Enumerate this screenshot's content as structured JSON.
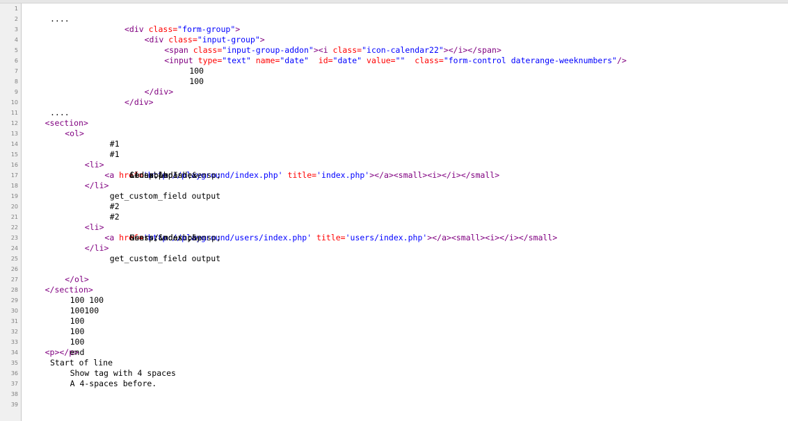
{
  "colors": {
    "text": "#000000",
    "tag": "#800080",
    "attribute": "#ff0000",
    "string": "#0000ff",
    "gutter_background": "#f0f0f0",
    "line_number": "#808080"
  },
  "lines": [
    {
      "n": "1",
      "indent": 0,
      "tokens": []
    },
    {
      "n": "2",
      "indent": 0,
      "tokens": [
        {
          "t": "txt",
          "v": "...."
        }
      ]
    },
    {
      "n": "3",
      "indent": 20,
      "tokens": [
        {
          "t": "tag",
          "v": "<div "
        },
        {
          "t": "attr",
          "v": "class="
        },
        {
          "t": "str",
          "v": "\"form-group\""
        },
        {
          "t": "tag",
          "v": ">"
        }
      ]
    },
    {
      "n": "4",
      "indent": 24,
      "tokens": [
        {
          "t": "tag",
          "v": "<div "
        },
        {
          "t": "attr",
          "v": "class="
        },
        {
          "t": "str",
          "v": "\"input-group\""
        },
        {
          "t": "tag",
          "v": ">"
        }
      ]
    },
    {
      "n": "5",
      "indent": 28,
      "tokens": [
        {
          "t": "tag",
          "v": "<span "
        },
        {
          "t": "attr",
          "v": "class="
        },
        {
          "t": "str",
          "v": "\"input-group-addon\""
        },
        {
          "t": "tag",
          "v": "><i "
        },
        {
          "t": "attr",
          "v": "class="
        },
        {
          "t": "str",
          "v": "\"icon-calendar22\""
        },
        {
          "t": "tag",
          "v": "></i></span>"
        }
      ]
    },
    {
      "n": "6",
      "indent": 28,
      "tokens": [
        {
          "t": "tag",
          "v": "<input "
        },
        {
          "t": "attr",
          "v": "type="
        },
        {
          "t": "str",
          "v": "\"text\""
        },
        {
          "t": "attr",
          "v": " name="
        },
        {
          "t": "str",
          "v": "\"date\""
        },
        {
          "t": "attr",
          "v": "  id="
        },
        {
          "t": "str",
          "v": "\"date\""
        },
        {
          "t": "attr",
          "v": " value="
        },
        {
          "t": "str",
          "v": "\"\""
        },
        {
          "t": "attr",
          "v": "  class="
        },
        {
          "t": "str",
          "v": "\"form-control daterange-weeknumbers\""
        },
        {
          "t": "tag",
          "v": "/>"
        }
      ]
    },
    {
      "n": "7",
      "indent": 28,
      "tokens": [
        {
          "t": "txt",
          "v": "100"
        }
      ]
    },
    {
      "n": "8",
      "indent": 28,
      "tokens": [
        {
          "t": "txt",
          "v": "100"
        }
      ]
    },
    {
      "n": "9",
      "indent": 24,
      "tokens": [
        {
          "t": "tag",
          "v": "</div>"
        }
      ]
    },
    {
      "n": "10",
      "indent": 20,
      "tokens": [
        {
          "t": "tag",
          "v": "</div>"
        }
      ]
    },
    {
      "n": "11",
      "indent": 0,
      "tokens": [
        {
          "t": "txt",
          "v": "...."
        }
      ]
    },
    {
      "n": "12",
      "indent": 4,
      "tokens": [
        {
          "t": "tag",
          "v": "<section>"
        }
      ]
    },
    {
      "n": "13",
      "indent": 8,
      "tokens": [
        {
          "t": "tag",
          "v": "<ol>"
        }
      ]
    },
    {
      "n": "14",
      "indent": 12,
      "tokens": [
        {
          "t": "txt",
          "v": "#1"
        }
      ]
    },
    {
      "n": "15",
      "indent": 12,
      "tokens": [
        {
          "t": "txt",
          "v": "#1"
        }
      ]
    },
    {
      "n": "16",
      "indent": 12,
      "tokens": [
        {
          "t": "tag",
          "v": "<li>"
        }
      ]
    },
    {
      "n": "17",
      "indent": 16,
      "tokens": [
        {
          "t": "tag",
          "v": "<a "
        },
        {
          "t": "attr",
          "v": "href="
        },
        {
          "t": "str",
          "v": "'http://playground/index.php'"
        },
        {
          "t": "attr",
          "v": " title="
        },
        {
          "t": "str",
          "v": "'index.php'"
        },
        {
          "t": "tag",
          "v": ">"
        },
        {
          "t": "txt",
          "v": "Clonable Index"
        },
        {
          "t": "tag",
          "v": "</a>"
        },
        {
          "t": "txt",
          "v": "&ensp;&mdash;&ensp;"
        },
        {
          "t": "tag",
          "v": "<small><i>"
        },
        {
          "t": "txt",
          "v": "index.php"
        },
        {
          "t": "tag",
          "v": "</i></small>"
        }
      ]
    },
    {
      "n": "18",
      "indent": 12,
      "tokens": [
        {
          "t": "tag",
          "v": "</li>"
        }
      ]
    },
    {
      "n": "19",
      "indent": 12,
      "tokens": [
        {
          "t": "txt",
          "v": "get_custom_field output"
        }
      ]
    },
    {
      "n": "20",
      "indent": 12,
      "tokens": [
        {
          "t": "txt",
          "v": "#2"
        }
      ]
    },
    {
      "n": "21",
      "indent": 12,
      "tokens": [
        {
          "t": "txt",
          "v": "#2"
        }
      ]
    },
    {
      "n": "22",
      "indent": 12,
      "tokens": [
        {
          "t": "tag",
          "v": "<li>"
        }
      ]
    },
    {
      "n": "23",
      "indent": 16,
      "tokens": [
        {
          "t": "tag",
          "v": "<a "
        },
        {
          "t": "attr",
          "v": "href="
        },
        {
          "t": "str",
          "v": "'http://playground/users/index.php'"
        },
        {
          "t": "attr",
          "v": " title="
        },
        {
          "t": "str",
          "v": "'users/index.php'"
        },
        {
          "t": "tag",
          "v": ">"
        },
        {
          "t": "txt",
          "v": "Users"
        },
        {
          "t": "tag",
          "v": "</a>"
        },
        {
          "t": "txt",
          "v": "&ensp;&mdash;&ensp;"
        },
        {
          "t": "tag",
          "v": "<small><i>"
        },
        {
          "t": "txt",
          "v": "users/index.php"
        },
        {
          "t": "tag",
          "v": "</i></small>"
        }
      ]
    },
    {
      "n": "24",
      "indent": 12,
      "tokens": [
        {
          "t": "tag",
          "v": "</li>"
        }
      ]
    },
    {
      "n": "25",
      "indent": 12,
      "tokens": [
        {
          "t": "txt",
          "v": "get_custom_field output"
        }
      ]
    },
    {
      "n": "26",
      "indent": 0,
      "tokens": []
    },
    {
      "n": "27",
      "indent": 8,
      "tokens": [
        {
          "t": "tag",
          "v": "</ol>"
        }
      ]
    },
    {
      "n": "28",
      "indent": 4,
      "tokens": [
        {
          "t": "tag",
          "v": "</section>"
        }
      ]
    },
    {
      "n": "29",
      "indent": 4,
      "tokens": [
        {
          "t": "txt",
          "v": "100 100"
        }
      ]
    },
    {
      "n": "30",
      "indent": 4,
      "tokens": [
        {
          "t": "txt",
          "v": "100100"
        }
      ]
    },
    {
      "n": "31",
      "indent": 4,
      "tokens": [
        {
          "t": "txt",
          "v": "100"
        }
      ]
    },
    {
      "n": "32",
      "indent": 4,
      "tokens": [
        {
          "t": "txt",
          "v": "100"
        }
      ]
    },
    {
      "n": "33",
      "indent": 4,
      "tokens": [
        {
          "t": "txt",
          "v": "100"
        }
      ]
    },
    {
      "n": "34",
      "indent": 4,
      "tokens": [
        {
          "t": "tag",
          "v": "<p>"
        },
        {
          "t": "txt",
          "v": "end"
        },
        {
          "t": "tag",
          "v": "</p>"
        }
      ]
    },
    {
      "n": "35",
      "indent": 0,
      "tokens": [
        {
          "t": "txt",
          "v": "Start of line"
        }
      ]
    },
    {
      "n": "36",
      "indent": 4,
      "tokens": [
        {
          "t": "txt",
          "v": "Show tag with 4 spaces"
        }
      ]
    },
    {
      "n": "37",
      "indent": 4,
      "tokens": [
        {
          "t": "txt",
          "v": "A 4-spaces before."
        }
      ]
    },
    {
      "n": "38",
      "indent": 0,
      "tokens": []
    },
    {
      "n": "39",
      "indent": 0,
      "tokens": []
    }
  ]
}
